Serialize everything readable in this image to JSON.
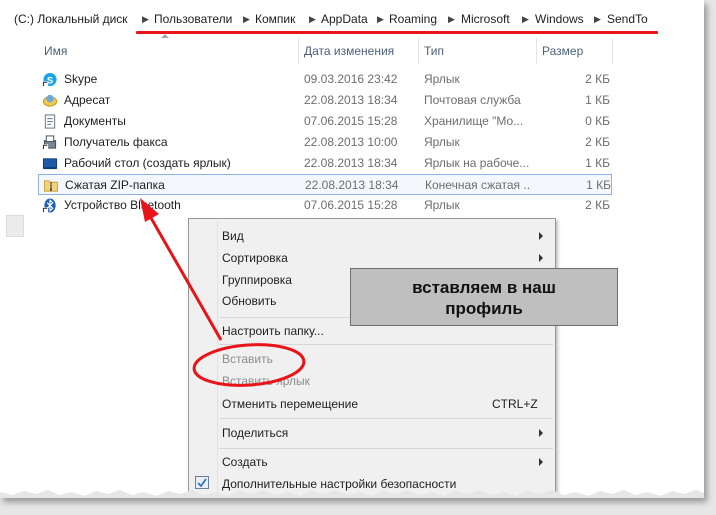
{
  "breadcrumb": {
    "items": [
      "(C:) Локальный диск",
      "Пользователи",
      "Компик",
      "AppData",
      "Roaming",
      "Microsoft",
      "Windows",
      "SendTo"
    ],
    "separator": "▶"
  },
  "columns": {
    "name": "Имя",
    "date": "Дата изменения",
    "type": "Тип",
    "size": "Размер"
  },
  "files": [
    {
      "name": "Skype",
      "date": "09.03.2016 23:42",
      "type": "Ярлык",
      "size": "2 КБ",
      "icon": "skype-icon"
    },
    {
      "name": "Адресат",
      "date": "22.08.2013 18:34",
      "type": "Почтовая служба",
      "size": "1 КБ",
      "icon": "mail-recipient-icon"
    },
    {
      "name": "Документы",
      "date": "07.06.2015 15:28",
      "type": "Хранилище \"Мо...",
      "size": "0 КБ",
      "icon": "documents-icon"
    },
    {
      "name": "Получатель факса",
      "date": "22.08.2013 10:00",
      "type": "Ярлык",
      "size": "2 КБ",
      "icon": "fax-icon"
    },
    {
      "name": "Рабочий стол (создать ярлык)",
      "date": "22.08.2013 18:34",
      "type": "Ярлык на рабоче...",
      "size": "1 КБ",
      "icon": "desktop-icon"
    },
    {
      "name": "Сжатая ZIP-папка",
      "date": "22.08.2013 18:34",
      "type": "Конечная сжатая ...",
      "size": "1 КБ",
      "icon": "zip-folder-icon"
    },
    {
      "name": "Устройство Bluetooth",
      "date": "07.06.2015 15:28",
      "type": "Ярлык",
      "size": "2 КБ",
      "icon": "bluetooth-icon"
    }
  ],
  "context_menu": {
    "view": "Вид",
    "sort": "Сортировка",
    "group": "Группировка",
    "refresh": "Обновить",
    "customize": "Настроить папку...",
    "paste": "Вставить",
    "paste_shortcut": "Вставить ярлык",
    "undo_move": "Отменить перемещение",
    "undo_shortcut": "CTRL+Z",
    "share": "Поделиться",
    "create": "Создать",
    "security": "Дополнительные настройки безопасности"
  },
  "annotation": {
    "line1": "вставляем в наш",
    "line2": "профиль"
  },
  "colors": {
    "annotation_red": "#e8141a",
    "header_text": "#4c607a",
    "selection_border": "#8db2e3"
  }
}
